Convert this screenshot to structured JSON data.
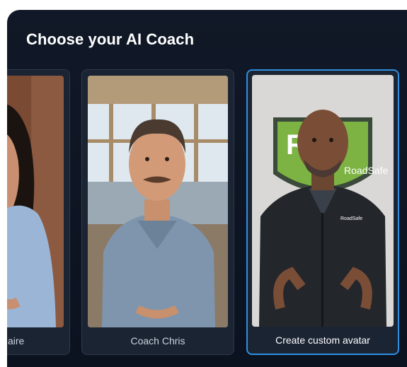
{
  "header": {
    "title": "Choose your AI Coach"
  },
  "coaches": [
    {
      "label": "aire",
      "selected": false
    },
    {
      "label": "Coach Chris",
      "selected": false
    },
    {
      "label": "Create custom avatar",
      "selected": true
    }
  ],
  "logo": {
    "badge_letters": "RU",
    "badge_text": "RoadSafe",
    "shirt_text": "RoadSafe"
  },
  "colors": {
    "panel_bg": "#111827",
    "card_bg": "#1b2433",
    "selected_border": "#2f8fe0"
  }
}
